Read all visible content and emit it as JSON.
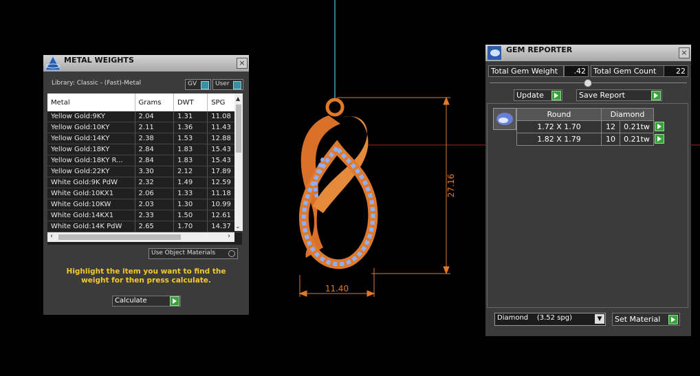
{
  "metal_weights": {
    "title": "METAL WEIGHTS",
    "close": "×",
    "library": "Library: Classic - (Fast)-Metal",
    "toggle_gv": "GV",
    "toggle_user": "User",
    "columns": [
      "Metal",
      "Grams",
      "DWT",
      "SPG"
    ],
    "rows": [
      [
        "Yellow Gold:9KY",
        "2.04",
        "1.31",
        "11.08"
      ],
      [
        "Yellow Gold:10KY",
        "2.11",
        "1.36",
        "11.43"
      ],
      [
        "Yellow Gold:14KY",
        "2.38",
        "1.53",
        "12.88"
      ],
      [
        "Yellow Gold:18KY",
        "2.84",
        "1.83",
        "15.43"
      ],
      [
        "Yellow Gold:18KY R...",
        "2.84",
        "1.83",
        "15.43"
      ],
      [
        "Yellow Gold:22KY",
        "3.30",
        "2.12",
        "17.89"
      ],
      [
        "White Gold:9K PdW",
        "2.32",
        "1.49",
        "12.59"
      ],
      [
        "White Gold:10KX1",
        "2.06",
        "1.33",
        "11.18"
      ],
      [
        "White Gold:10KW",
        "2.03",
        "1.30",
        "10.99"
      ],
      [
        "White Gold:14KX1",
        "2.33",
        "1.50",
        "12.61"
      ],
      [
        "White Gold:14K PdW",
        "2.65",
        "1.70",
        "14.37"
      ]
    ],
    "use_object_materials": "Use Object Materials",
    "message": "Highlight the item you want to find the weight for then press calculate.",
    "calculate": "Calculate"
  },
  "viewport": {
    "height_dim": "27.16",
    "width_dim": "11.40",
    "accent_orange": "#e07a2a",
    "gem_blue": "#8fb0ff"
  },
  "gem_reporter": {
    "title": "GEM REPORTER",
    "close": "×",
    "total_weight_label": "Total Gem Weight",
    "total_weight_value": ".42",
    "total_count_label": "Total Gem Count",
    "total_count_value": "22",
    "update": "Update",
    "save_report": "Save Report",
    "table_headers": [
      "Round",
      "Diamond"
    ],
    "rows": [
      [
        "1.72 X 1.70",
        "12",
        "0.21tw"
      ],
      [
        "1.82 X 1.79",
        "10",
        "0.21tw"
      ]
    ],
    "material_select": "Diamond    (3.52 spg)",
    "set_material": "Set Material"
  }
}
